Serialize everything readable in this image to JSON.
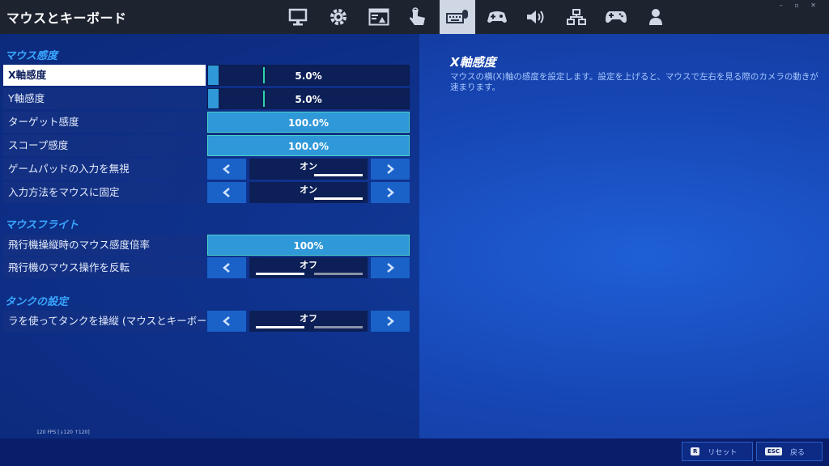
{
  "window": {
    "title": "マウスとキーボード",
    "controls": "– ▫ ✕"
  },
  "nav_tabs": [
    {
      "icon": "monitor-icon",
      "active": false
    },
    {
      "icon": "gear-icon",
      "active": false
    },
    {
      "icon": "window-icon",
      "active": false
    },
    {
      "icon": "touch-icon",
      "active": false
    },
    {
      "icon": "keyboard-mouse-icon",
      "active": true
    },
    {
      "icon": "controller-gear-icon",
      "active": false
    },
    {
      "icon": "speaker-icon",
      "active": false
    },
    {
      "icon": "network-icon",
      "active": false
    },
    {
      "icon": "gamepad-icon",
      "active": false
    },
    {
      "icon": "account-icon",
      "active": false
    }
  ],
  "sections": {
    "mouse_sensitivity": "マウス感度",
    "mouse_flight": "マウスフライト",
    "tank": "タンクの設定"
  },
  "settings": {
    "x_sensitivity": {
      "label": "X軸感度",
      "value": "5.0%",
      "fill": 0.05
    },
    "y_sensitivity": {
      "label": "Y軸感度",
      "value": "5.0%",
      "fill": 0.05
    },
    "target_sensitivity": {
      "label": "ターゲット感度",
      "value": "100.0%",
      "fill": 1.0
    },
    "scope_sensitivity": {
      "label": "スコープ感度",
      "value": "100.0%",
      "fill": 1.0
    },
    "ignore_gamepad": {
      "label": "ゲームパッドの入力を無視",
      "value": "オン",
      "on": true
    },
    "lock_mouse_input": {
      "label": "入力方法をマウスに固定",
      "value": "オン",
      "on": true
    },
    "flight_multiplier": {
      "label": "飛行機操縦時のマウス感度倍率",
      "value": "100%",
      "fill": 1.0
    },
    "invert_flight": {
      "label": "飛行機のマウス操作を反転",
      "value": "オフ",
      "on": false
    },
    "tank_mouse": {
      "label": "ラを使ってタンクを操縦 (マウスとキーボー",
      "value": "オフ",
      "on": false
    }
  },
  "detail": {
    "title": "X軸感度",
    "description": "マウスの横(X)軸の感度を設定します。設定を上げると、マウスで左右を見る際のカメラの動きが速まります。"
  },
  "status": {
    "fps": "120 FPS [↓120 ↑120]"
  },
  "footer": {
    "reset": {
      "key": "R",
      "label": "リセット"
    },
    "back": {
      "key": "ESC",
      "label": "戻る"
    }
  },
  "colors": {
    "accent_blue": "#2f98d8",
    "section_header": "#39a6ff",
    "toggle_on": "#ffffff",
    "toggle_off_track": "#8a93a8",
    "teal_marker": "#2fd4a9"
  }
}
